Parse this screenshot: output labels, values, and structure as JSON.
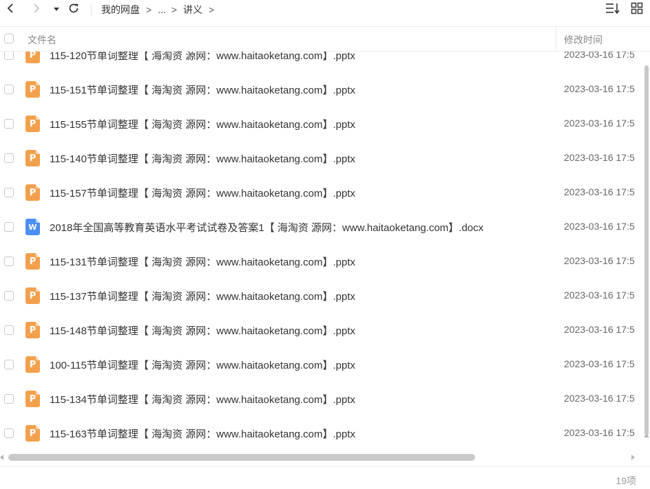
{
  "toolbar": {
    "breadcrumb": {
      "root": "我的网盘",
      "ellipsis": "...",
      "current": "讲义",
      "separator": ">"
    },
    "icons": {
      "back": "chevron-left-icon",
      "forward": "chevron-right-icon",
      "history": "dropdown-caret-icon",
      "refresh": "refresh-icon",
      "sort": "sort-icon",
      "view": "grid-view-icon"
    }
  },
  "header": {
    "name_label": "文件名",
    "time_label": "修改时间"
  },
  "files": [
    {
      "name": "115-120节单词整理【 海淘资 源网：www.haitaoketang.com】.pptx",
      "type": "pptx",
      "icon_letter": "P",
      "time": "2023-03-16 17:5"
    },
    {
      "name": "115-151节单词整理【 海淘资 源网：www.haitaoketang.com】.pptx",
      "type": "pptx",
      "icon_letter": "P",
      "time": "2023-03-16 17:5"
    },
    {
      "name": "115-155节单词整理【 海淘资 源网：www.haitaoketang.com】.pptx",
      "type": "pptx",
      "icon_letter": "P",
      "time": "2023-03-16 17:5"
    },
    {
      "name": "115-140节单词整理【 海淘资 源网：www.haitaoketang.com】.pptx",
      "type": "pptx",
      "icon_letter": "P",
      "time": "2023-03-16 17:5"
    },
    {
      "name": "115-157节单词整理【 海淘资 源网：www.haitaoketang.com】.pptx",
      "type": "pptx",
      "icon_letter": "P",
      "time": "2023-03-16 17:5"
    },
    {
      "name": "2018年全国高等教育英语水平考试试卷及答案1【 海淘资 源网：www.haitaoketang.com】.docx",
      "type": "docx",
      "icon_letter": "W",
      "time": "2023-03-16 17:5"
    },
    {
      "name": "115-131节单词整理【 海淘资 源网：www.haitaoketang.com】.pptx",
      "type": "pptx",
      "icon_letter": "P",
      "time": "2023-03-16 17:5"
    },
    {
      "name": "115-137节单词整理【 海淘资 源网：www.haitaoketang.com】.pptx",
      "type": "pptx",
      "icon_letter": "P",
      "time": "2023-03-16 17:5"
    },
    {
      "name": "115-148节单词整理【 海淘资 源网：www.haitaoketang.com】.pptx",
      "type": "pptx",
      "icon_letter": "P",
      "time": "2023-03-16 17:5"
    },
    {
      "name": "100-115节单词整理【 海淘资 源网：www.haitaoketang.com】.pptx",
      "type": "pptx",
      "icon_letter": "P",
      "time": "2023-03-16 17:5"
    },
    {
      "name": "115-134节单词整理【 海淘资 源网：www.haitaoketang.com】.pptx",
      "type": "pptx",
      "icon_letter": "P",
      "time": "2023-03-16 17:5"
    },
    {
      "name": "115-163节单词整理【 海淘资 源网：www.haitaoketang.com】.pptx",
      "type": "pptx",
      "icon_letter": "P",
      "time": "2023-03-16 17:5"
    }
  ],
  "footer": {
    "count": "19项"
  },
  "colors": {
    "pptx_icon": "#f3a04d",
    "docx_icon": "#4a8ff1",
    "scrollbar": "#c9c9c9"
  }
}
